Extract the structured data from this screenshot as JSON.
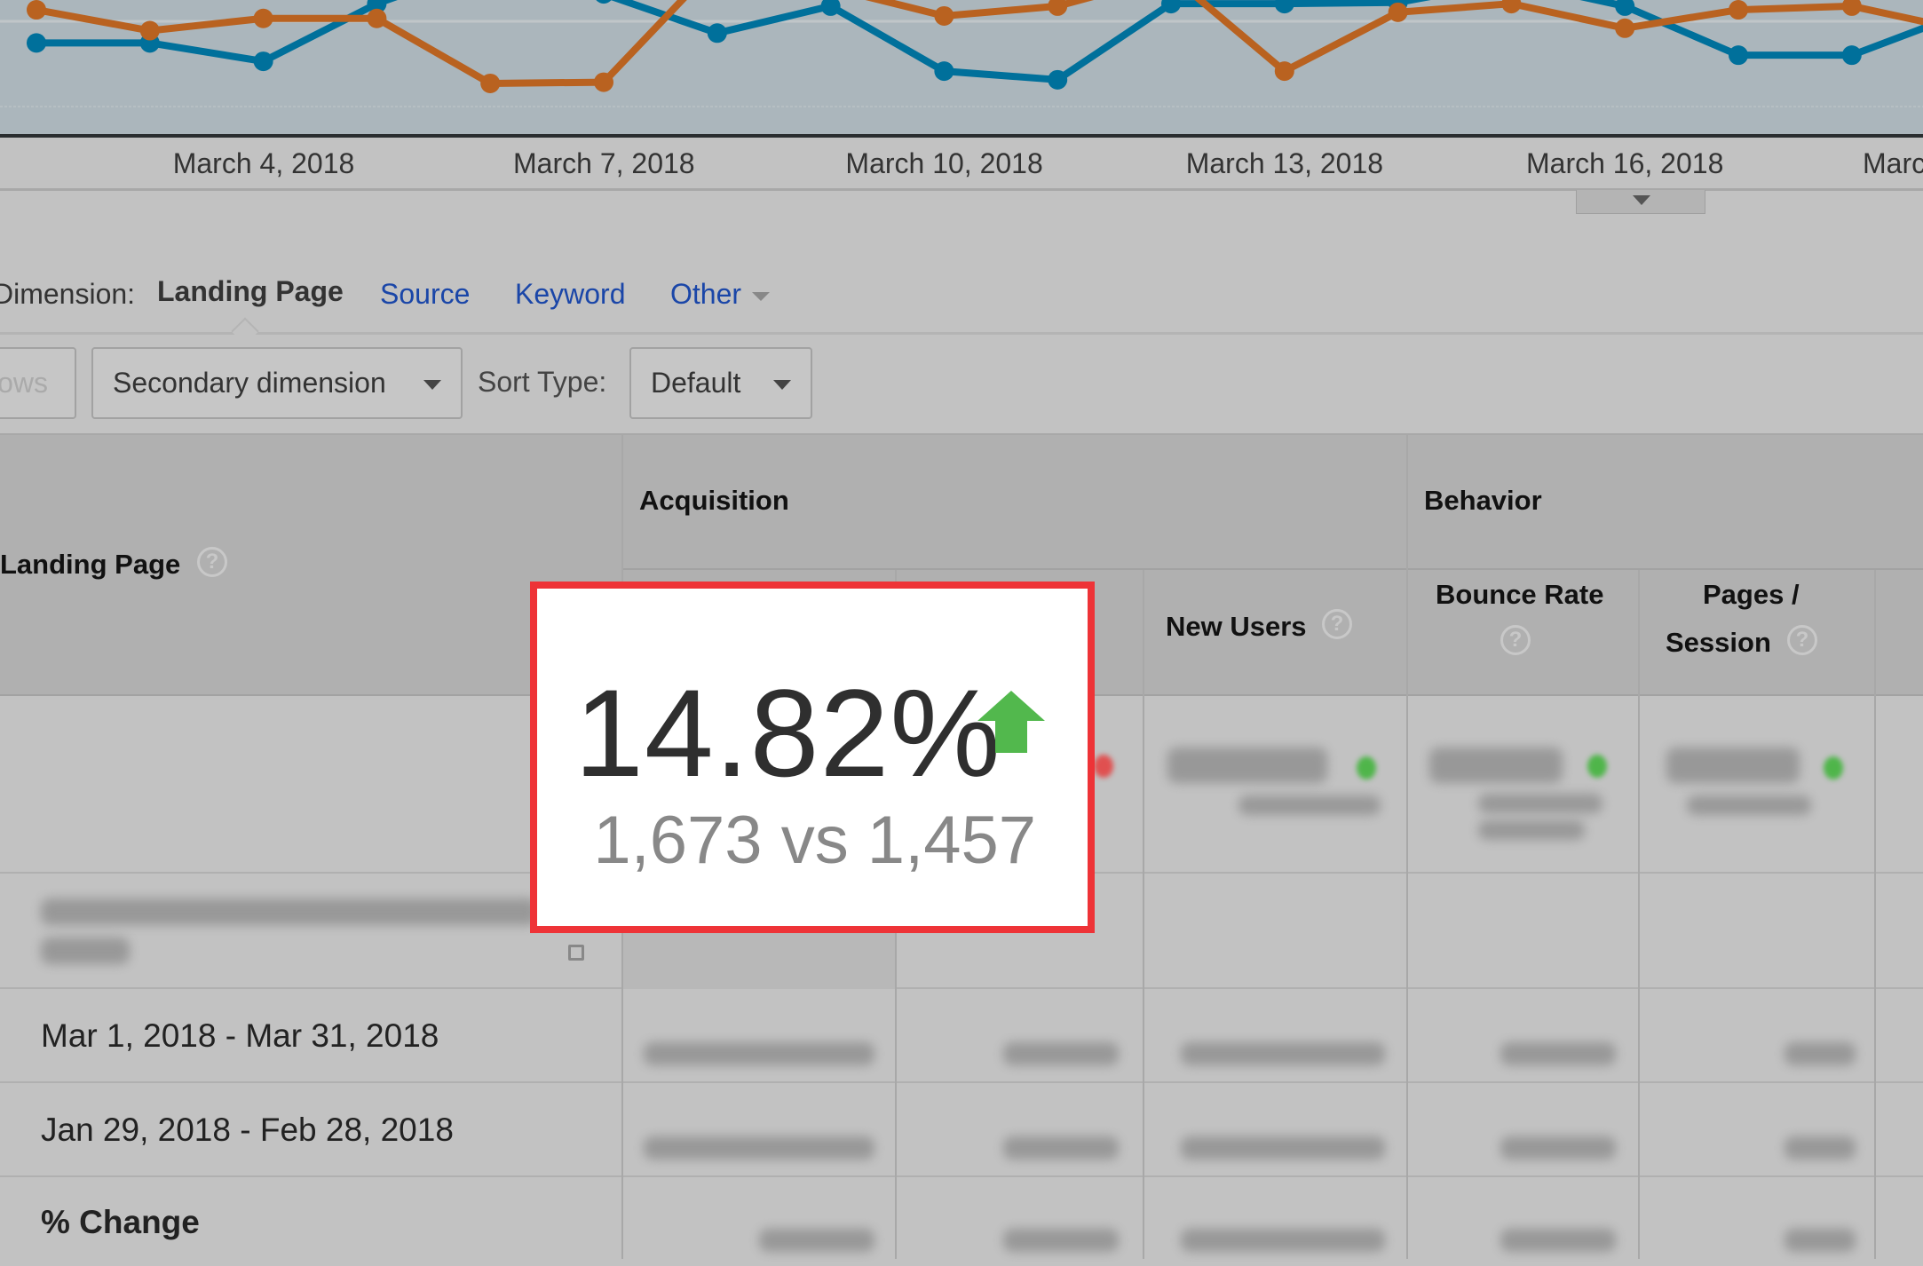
{
  "chart_data": {
    "type": "line",
    "x": [
      "March 2, 2018",
      "March 3, 2018",
      "March 4, 2018",
      "March 5, 2018",
      "March 6, 2018",
      "March 7, 2018",
      "March 8, 2018",
      "March 9, 2018",
      "March 10, 2018",
      "March 11, 2018",
      "March 12, 2018",
      "March 13, 2018",
      "March 14, 2018",
      "March 15, 2018",
      "March 16, 2018",
      "March 17, 2018",
      "March 18, 2018",
      "March 19, 2018"
    ],
    "tick_labels": [
      "March 4, 2018",
      "March 7, 2018",
      "March 10, 2018",
      "March 13, 2018",
      "March 16, 2018",
      "Marc"
    ],
    "series": [
      {
        "color": "#00709b",
        "values": [
          75,
          75,
          60,
          107,
          140,
          115,
          83,
          105,
          52,
          45,
          107,
          107,
          108,
          125,
          105,
          65,
          65,
          100
        ]
      },
      {
        "color": "#b96220",
        "values": [
          102,
          85,
          95,
          95,
          42,
          43,
          140,
          120,
          97,
          105,
          130,
          52,
          100,
          107,
          87,
          102,
          105,
          85
        ]
      }
    ],
    "ylim": [
      0,
      110
    ],
    "grid": true
  },
  "dimension": {
    "label": "Dimension:",
    "active": "Landing Page",
    "links": [
      "Source",
      "Keyword",
      "Other"
    ]
  },
  "toolbar": {
    "rows_label": "Rows",
    "secondary_dimension": "Secondary dimension",
    "sort_type_label": "Sort Type:",
    "sort_type_value": "Default"
  },
  "table": {
    "first_col_header": "Landing Page",
    "groups": [
      "Acquisition",
      "Behavior"
    ],
    "columns": [
      "New Users",
      "Bounce Rate",
      "Pages /",
      "Session"
    ],
    "rows": [
      "Mar 1, 2018 - Mar 31, 2018",
      "Jan 29, 2018 - Feb 28, 2018",
      "% Change"
    ]
  },
  "popup": {
    "value": "14.82%",
    "comparison": "1,673 vs 1,457",
    "trend": "up",
    "up_color": "#52b84d",
    "border_color": "#ee3337"
  }
}
